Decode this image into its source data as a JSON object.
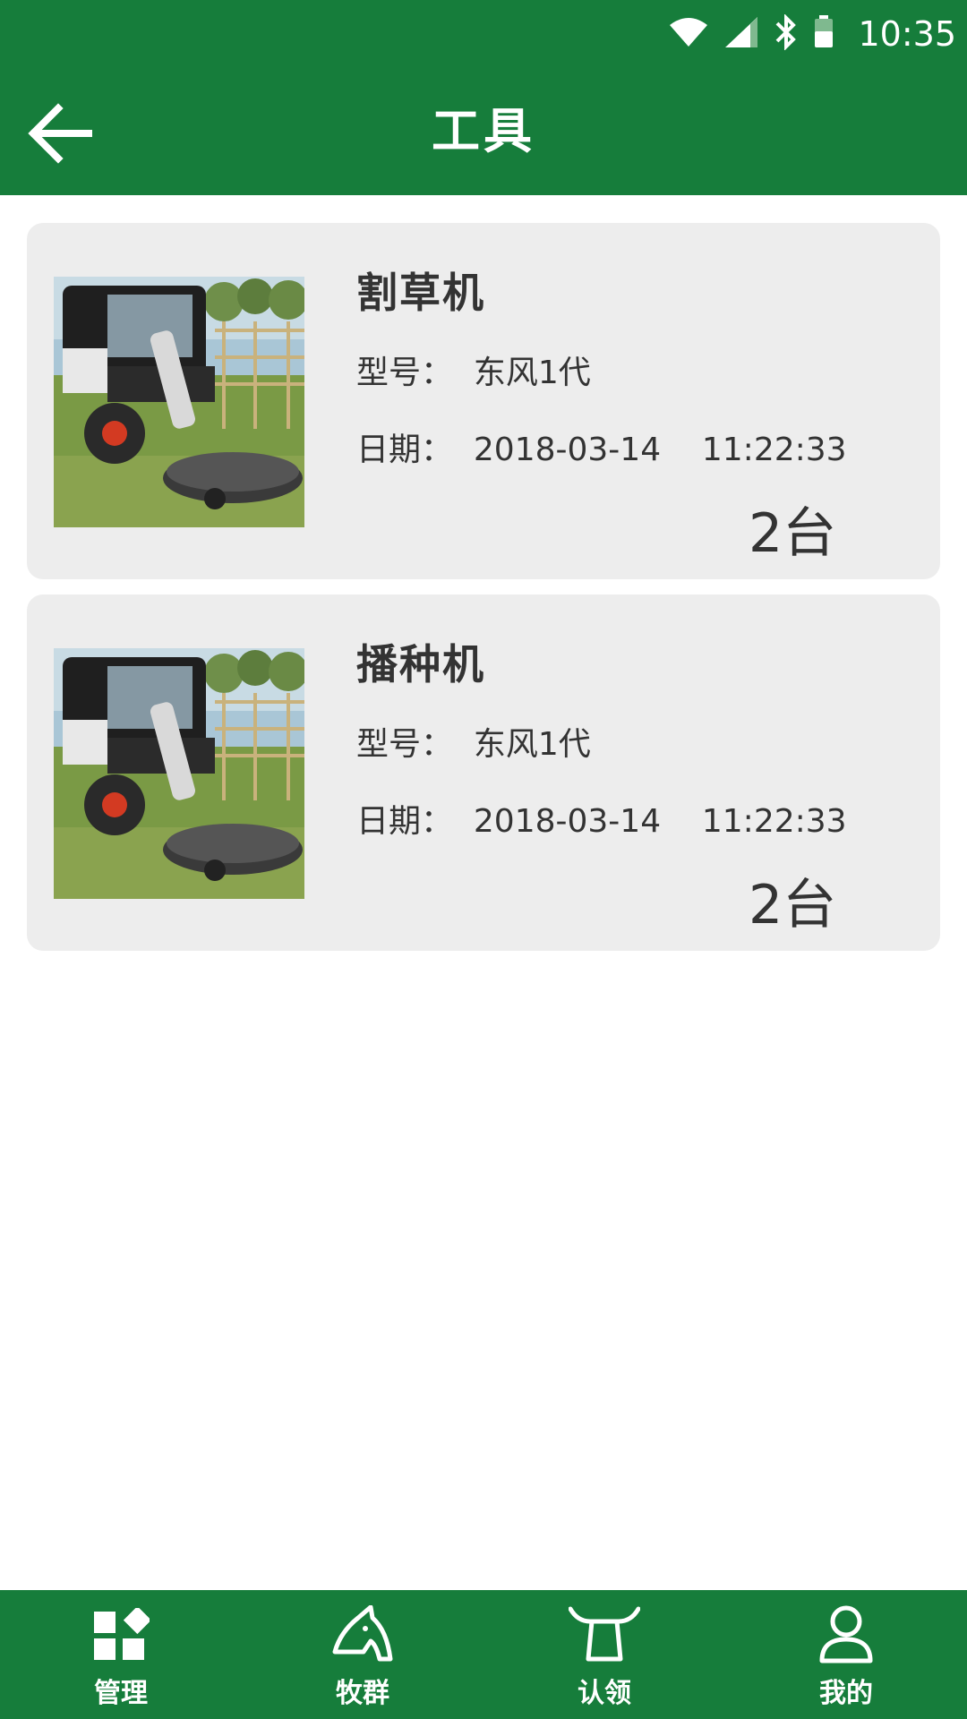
{
  "status_bar": {
    "time": "10:35",
    "icons": [
      "wifi-icon",
      "cell-signal-icon",
      "bluetooth-icon",
      "battery-icon"
    ]
  },
  "header": {
    "title": "工具",
    "back_icon": "arrow-left-icon"
  },
  "tools": [
    {
      "name": "割草机",
      "model": "型号：  东风1代",
      "date": "日期：  2018-03-14    11:22:33",
      "count": "2台",
      "image": "mower-photo"
    },
    {
      "name": "播种机",
      "model": "型号：  东风1代",
      "date": "日期：  2018-03-14    11:22:33",
      "count": "2台",
      "image": "mower-photo"
    }
  ],
  "bottom_nav": [
    {
      "label": "管理",
      "icon": "grid-icon"
    },
    {
      "label": "牧群",
      "icon": "horse-head-icon"
    },
    {
      "label": "认领",
      "icon": "bull-horns-icon"
    },
    {
      "label": "我的",
      "icon": "person-icon"
    }
  ],
  "colors": {
    "primary": "#167d3b",
    "card_bg": "#ededed",
    "text": "#333333"
  }
}
